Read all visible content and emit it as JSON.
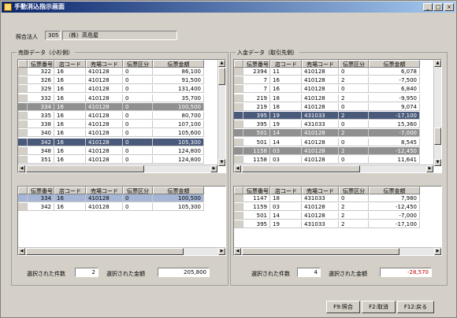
{
  "window": {
    "title": "手動消込指示画面",
    "min": "_",
    "max": "□",
    "close": "×"
  },
  "company": {
    "label": "照合法人",
    "code": "305",
    "name": "（株）高島屋"
  },
  "left": {
    "group_title": "売掛データ（小杉側）",
    "headers": [
      "伝票番号",
      "店コード",
      "売場コード",
      "伝票区分",
      "伝票金額"
    ],
    "rows": [
      [
        "322",
        "16",
        "410128",
        "0",
        "86,100"
      ],
      [
        "326",
        "16",
        "410128",
        "0",
        "91,500"
      ],
      [
        "329",
        "16",
        "410128",
        "0",
        "131,400"
      ],
      [
        "332",
        "16",
        "410128",
        "0",
        "35,700"
      ],
      [
        "334",
        "16",
        "410128",
        "0",
        "100,500"
      ],
      [
        "335",
        "16",
        "410128",
        "0",
        "80,700"
      ],
      [
        "338",
        "16",
        "410128",
        "0",
        "107,100"
      ],
      [
        "340",
        "16",
        "410128",
        "0",
        "105,600"
      ],
      [
        "342",
        "16",
        "410128",
        "0",
        "105,300"
      ],
      [
        "348",
        "16",
        "410128",
        "0",
        "124,800"
      ],
      [
        "351",
        "16",
        "410128",
        "0",
        "124,800"
      ]
    ],
    "selected_rows": [
      [
        "334",
        "16",
        "410128",
        "0",
        "100,500"
      ],
      [
        "342",
        "16",
        "410128",
        "0",
        "105,300"
      ]
    ],
    "count_label": "選択された件数",
    "count": "2",
    "amount_label": "選択された金額",
    "amount": "205,800"
  },
  "right": {
    "group_title": "入金データ（取引先側）",
    "headers": [
      "伝票番号",
      "店コード",
      "売場コード",
      "伝票区分",
      "伝票金額"
    ],
    "rows": [
      [
        "2394",
        "11",
        "410128",
        "0",
        "6,078"
      ],
      [
        "7",
        "16",
        "410128",
        "2",
        "-7,500"
      ],
      [
        "7",
        "16",
        "410128",
        "0",
        "6,840"
      ],
      [
        "219",
        "18",
        "410128",
        "2",
        "-9,950"
      ],
      [
        "219",
        "18",
        "410128",
        "0",
        "9,074"
      ],
      [
        "395",
        "19",
        "431033",
        "2",
        "-17,100"
      ],
      [
        "395",
        "19",
        "431033",
        "0",
        "15,360"
      ],
      [
        "501",
        "14",
        "410128",
        "2",
        "-7,000"
      ],
      [
        "501",
        "14",
        "410128",
        "0",
        "8,545"
      ],
      [
        "1158",
        "03",
        "410128",
        "2",
        "-12,450"
      ],
      [
        "1158",
        "03",
        "410128",
        "0",
        "11,641"
      ]
    ],
    "selected_rows": [
      [
        "1147",
        "18",
        "431033",
        "0",
        "7,980"
      ],
      [
        "1159",
        "03",
        "410128",
        "2",
        "-12,450"
      ],
      [
        "501",
        "14",
        "410128",
        "2",
        "-7,000"
      ],
      [
        "395",
        "19",
        "431033",
        "2",
        "-17,100"
      ]
    ],
    "count_label": "選択された件数",
    "count": "4",
    "amount_label": "選択された金額",
    "amount": "-28,570"
  },
  "buttons": {
    "match": "F9:照合",
    "cancel": "F2:取消",
    "back": "F12:戻る"
  },
  "colors": {
    "dark_select": "#4a5a7a",
    "gray_select": "#909090",
    "light_select": "#a6b6d6",
    "negative": "#c00000"
  }
}
